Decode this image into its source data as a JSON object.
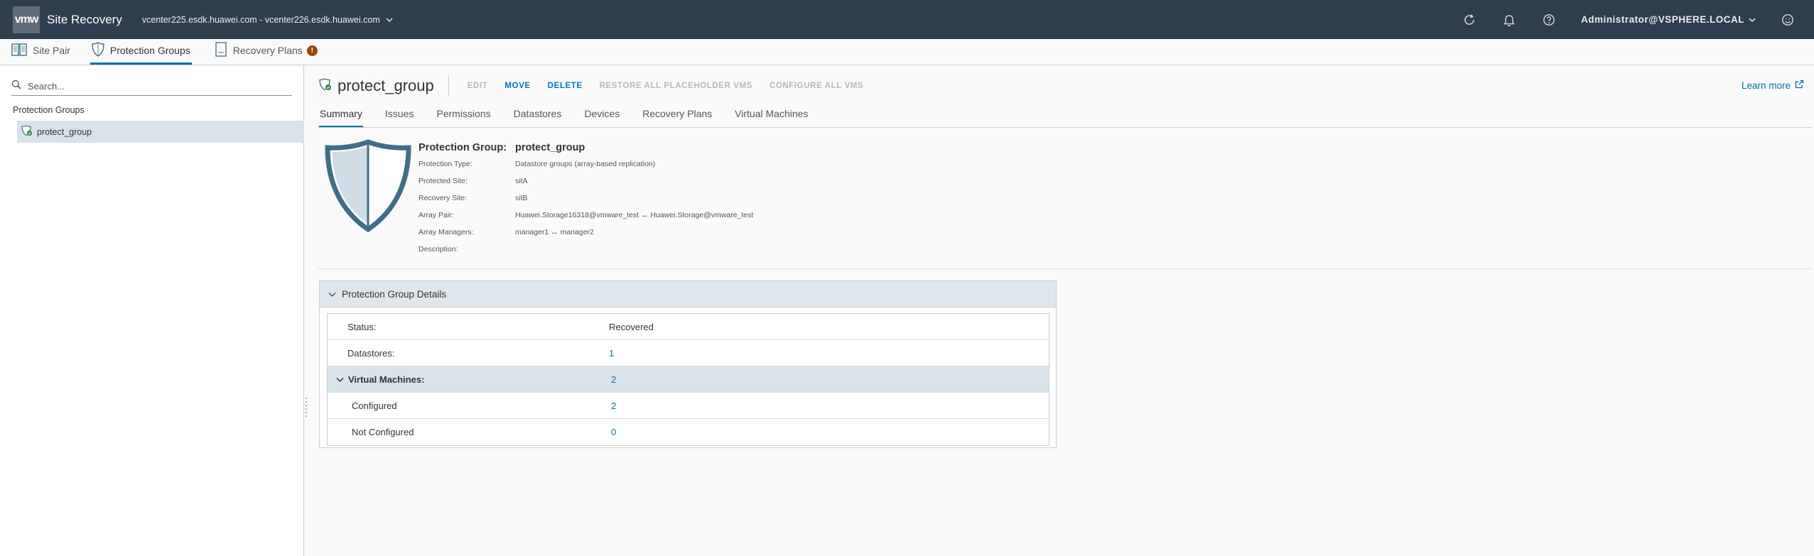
{
  "header": {
    "logo": "vmw",
    "app_title": "Site Recovery",
    "vcenter_pair": "vcenter225.esdk.huawei.com - vcenter226.esdk.huawei.com",
    "user": "Administrator@VSPHERE.LOCAL",
    "icons": [
      "refresh-icon",
      "bell-icon",
      "help-icon",
      "chevron-down-icon",
      "smiley-icon"
    ]
  },
  "tabs": [
    {
      "label": "Site Pair",
      "icon": "site-pair-icon"
    },
    {
      "label": "Protection Groups",
      "icon": "shield-icon",
      "active": true
    },
    {
      "label": "Recovery Plans",
      "icon": "document-icon",
      "badge": "!"
    }
  ],
  "sidebar": {
    "search_placeholder": "Search...",
    "section_title": "Protection Groups",
    "items": [
      {
        "label": "protect_group",
        "selected": true
      }
    ]
  },
  "object": {
    "title": "protect_group",
    "actions": [
      {
        "label": "EDIT",
        "enabled": false
      },
      {
        "label": "MOVE",
        "enabled": true
      },
      {
        "label": "DELETE",
        "enabled": true
      },
      {
        "label": "RESTORE ALL PLACEHOLDER VMS",
        "enabled": false
      },
      {
        "label": "CONFIGURE ALL VMS",
        "enabled": false
      }
    ],
    "learn_more": "Learn more"
  },
  "subtabs": [
    "Summary",
    "Issues",
    "Permissions",
    "Datastores",
    "Devices",
    "Recovery Plans",
    "Virtual Machines"
  ],
  "summary": {
    "group_label": "Protection Group:",
    "group_value": "protect_group",
    "props": [
      {
        "key": "Protection Type:",
        "value": "Datastore groups (array-based replication)"
      },
      {
        "key": "Protected Site:",
        "value": "sitA"
      },
      {
        "key": "Recovery Site:",
        "value": "sitB"
      },
      {
        "key": "Array Pair:",
        "value": "Huawei.Storage16318@vmware_test ↔ Huawei.Storage@vmware_test"
      },
      {
        "key": "Array Managers:",
        "value": "manager1 ↔ manager2"
      },
      {
        "key": "Description:",
        "value": ""
      }
    ]
  },
  "details": {
    "title": "Protection Group Details",
    "status_label": "Status:",
    "status_value": "Recovered",
    "datastores_label": "Datastores:",
    "datastores_value": "1",
    "vms_label": "Virtual Machines:",
    "vms_value": "2",
    "configured_label": "Configured",
    "configured_value": "2",
    "not_configured_label": "Not Configured",
    "not_configured_value": "0"
  },
  "colors": {
    "header_bg": "#2e3e4e",
    "accent": "#0072a3",
    "selected_row": "#d8e3e9",
    "badge": "#9a4900",
    "shield": "#3f6e88"
  }
}
